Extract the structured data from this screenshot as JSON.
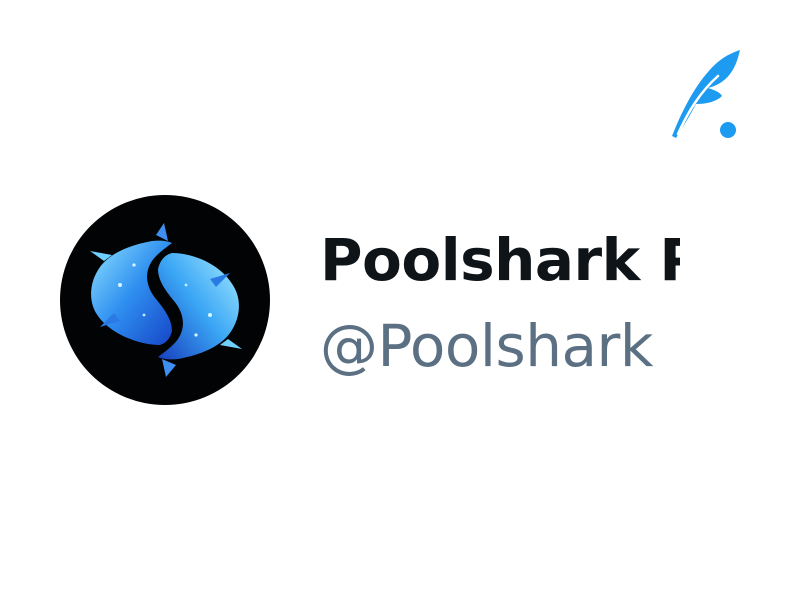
{
  "brand": {
    "logo_icon": "quill-feather-icon",
    "color": "#1d9bf0"
  },
  "profile": {
    "avatar_icon": "twin-sharks-icon",
    "display_name": "Poolshark P",
    "handle": "@Poolshark",
    "name_color": "#0f1419",
    "handle_color": "#5b7083"
  }
}
